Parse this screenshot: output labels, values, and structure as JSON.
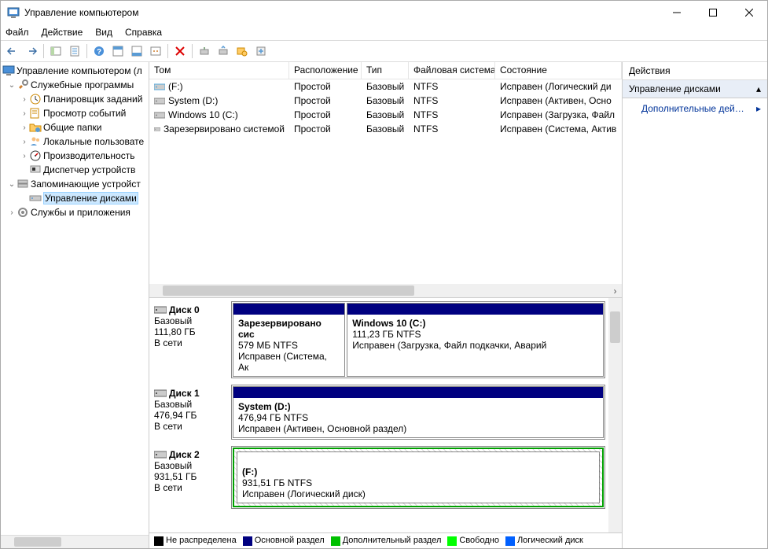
{
  "window": {
    "title": "Управление компьютером"
  },
  "menu": {
    "file": "Файл",
    "action": "Действие",
    "view": "Вид",
    "help": "Справка"
  },
  "tree": {
    "root": "Управление компьютером (л",
    "system_tools": "Служебные программы",
    "task_scheduler": "Планировщик заданий",
    "event_viewer": "Просмотр событий",
    "shared_folders": "Общие папки",
    "local_users": "Локальные пользовате",
    "performance": "Производительность",
    "device_manager": "Диспетчер устройств",
    "storage": "Запоминающие устройст",
    "disk_management": "Управление дисками",
    "services": "Службы и приложения"
  },
  "vol_columns": {
    "vol": "Том",
    "layout": "Расположение",
    "type": "Тип",
    "fs": "Файловая система",
    "status": "Состояние"
  },
  "volumes": [
    {
      "name": "(F:)",
      "layout": "Простой",
      "type": "Базовый",
      "fs": "NTFS",
      "status": "Исправен (Логический ди"
    },
    {
      "name": "System (D:)",
      "layout": "Простой",
      "type": "Базовый",
      "fs": "NTFS",
      "status": "Исправен (Активен, Осно"
    },
    {
      "name": "Windows 10 (C:)",
      "layout": "Простой",
      "type": "Базовый",
      "fs": "NTFS",
      "status": "Исправен (Загрузка, Файл"
    },
    {
      "name": "Зарезервировано системой",
      "layout": "Простой",
      "type": "Базовый",
      "fs": "NTFS",
      "status": "Исправен (Система, Актив"
    }
  ],
  "disks": [
    {
      "name": "Диск 0",
      "kind": "Базовый",
      "size": "111,80 ГБ",
      "state": "В сети",
      "parts": [
        {
          "title": "Зарезервировано сис",
          "sub": "579 МБ NTFS",
          "status": "Исправен (Система, Ак",
          "stripe": "c-navy",
          "flex": 1
        },
        {
          "title": "Windows 10  (C:)",
          "sub": "111,23 ГБ NTFS",
          "status": "Исправен (Загрузка, Файл подкачки, Аварий",
          "stripe": "c-navy",
          "flex": 2.3
        }
      ]
    },
    {
      "name": "Диск 1",
      "kind": "Базовый",
      "size": "476,94 ГБ",
      "state": "В сети",
      "parts": [
        {
          "title": "System  (D:)",
          "sub": "476,94 ГБ NTFS",
          "status": "Исправен (Активен, Основной раздел)",
          "stripe": "c-navy",
          "flex": 1
        }
      ]
    },
    {
      "name": "Диск 2",
      "kind": "Базовый",
      "size": "931,51 ГБ",
      "state": "В сети",
      "parts": [
        {
          "title": "(F:)",
          "sub": "931,51 ГБ NTFS",
          "status": "Исправен (Логический диск)",
          "stripe": "c-blue",
          "flex": 1,
          "logical": true
        }
      ]
    }
  ],
  "legend": {
    "unallocated": "Не распределена",
    "primary": "Основной раздел",
    "extended": "Дополнительный раздел",
    "free": "Свободно",
    "logical": "Логический диск"
  },
  "actions": {
    "header": "Действия",
    "group": "Управление дисками",
    "more": "Дополнительные дей…"
  }
}
